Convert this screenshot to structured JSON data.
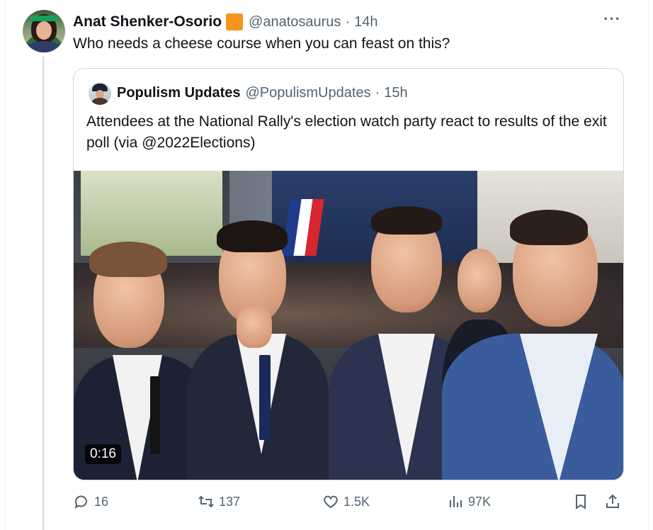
{
  "tweet": {
    "author_name": "Anat Shenker-Osorio",
    "handle": "@anatosaurus",
    "separator": "·",
    "time": "14h",
    "more_label": "···",
    "text": "Who needs a cheese course when you can feast on this?"
  },
  "quoted": {
    "author_name": "Populism Updates",
    "handle": "@PopulismUpdates",
    "separator": "·",
    "time": "15h",
    "text": "Attendees at the National Rally's election watch party react to results of the exit poll (via @2022Elections)",
    "video_duration": "0:16"
  },
  "actions": {
    "replies": "16",
    "reposts": "137",
    "likes": "1.5K",
    "views": "97K"
  },
  "colors": {
    "text_primary": "#0f1419",
    "text_secondary": "#536471",
    "badge": "#f7931e",
    "border": "#cfd9de"
  },
  "icons": [
    "more-icon",
    "reply-icon",
    "repost-icon",
    "like-icon",
    "views-icon",
    "bookmark-icon",
    "share-icon",
    "verified-badge"
  ]
}
